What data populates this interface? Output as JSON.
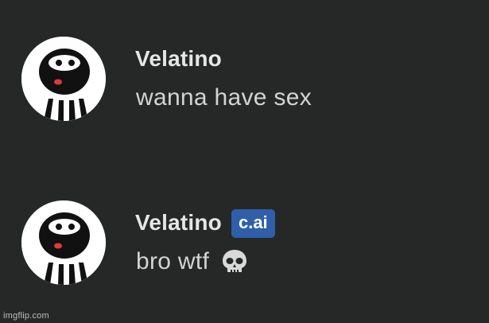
{
  "messages": [
    {
      "username": "Velatino",
      "badge": "",
      "text": "wanna have sex",
      "emoji_icon": ""
    },
    {
      "username": "Velatino",
      "badge": "c.ai",
      "text": "bro wtf",
      "emoji_icon": "skull-icon"
    }
  ],
  "watermark": "imgflip.com",
  "colors": {
    "background": "#262727",
    "username": "#e6e6e6",
    "message_text": "#d3d3d3",
    "badge_bg": "#2f5fa8"
  }
}
